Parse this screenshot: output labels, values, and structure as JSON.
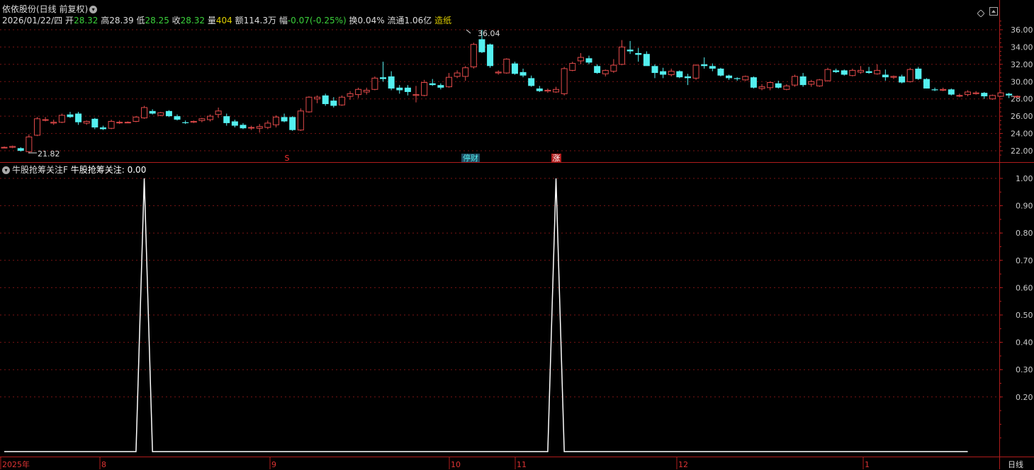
{
  "colors": {
    "up": "#e24a4a",
    "down": "#54f0f0",
    "grid": "#7a1414",
    "axis": "#b01c1c",
    "text": "#dddddd",
    "yellow": "#e0d000",
    "green": "#3bd13b",
    "red": "#ff4040"
  },
  "header": {
    "title": "依依股份(日线 前复权)",
    "date": "2026/01/22/四",
    "open_label": "开",
    "open": "28.32",
    "high_label": "高",
    "high": "28.39",
    "low_label": "低",
    "low": "28.25",
    "close_label": "收",
    "close": "28.32",
    "vol_label": "量",
    "vol": "404",
    "amt_label": "额",
    "amt": "114.3万",
    "chg_label": "幅",
    "chg": "-0.07(-0.25%)",
    "turn_label": "换",
    "turn": "0.04%",
    "float_label": "流通",
    "float": "1.06亿",
    "sector": "造纸"
  },
  "indicator": {
    "name": "牛股抢筹关注F",
    "label": "牛股抢筹关注:",
    "value": "0.00"
  },
  "price_axis": {
    "ticks": [
      "36.00",
      "34.00",
      "32.00",
      "30.00",
      "28.00",
      "26.00",
      "24.00",
      "22.00"
    ]
  },
  "ind_axis": {
    "ticks": [
      "1.00",
      "0.90",
      "0.80",
      "0.70",
      "0.60",
      "0.50",
      "0.40",
      "0.30",
      "0.20"
    ]
  },
  "annotations": {
    "high": "36.04",
    "low": "21.82"
  },
  "markers": [
    {
      "text": "S",
      "color": "#ff3030",
      "bg": "none",
      "x": 405
    },
    {
      "text": "停财",
      "color": "#54f0f0",
      "bg": "#1e4a60",
      "x": 664
    },
    {
      "text": "涨",
      "color": "#ffffff",
      "bg": "#b01c1c",
      "x": 785
    }
  ],
  "x_axis": {
    "labels": [
      {
        "text": "2025年",
        "x": 3
      },
      {
        "text": "8",
        "x": 143
      },
      {
        "text": "9",
        "x": 383
      },
      {
        "text": "10",
        "x": 636
      },
      {
        "text": "11",
        "x": 729
      },
      {
        "text": "12",
        "x": 957
      },
      {
        "text": "1",
        "x": 1220
      }
    ],
    "period": "日线"
  },
  "chart_data": [
    {
      "type": "candlestick",
      "title": "依依股份(日线 前复权)",
      "ylim": [
        21,
        37
      ],
      "y_ticks": [
        22,
        24,
        26,
        28,
        30,
        32,
        34,
        36
      ],
      "series": [
        {
          "values_ohlc": [
            [
              22.4,
              22.5,
              22.3,
              22.4
            ],
            [
              22.4,
              22.6,
              22.3,
              22.5
            ],
            [
              22.3,
              22.4,
              21.9,
              22.0
            ],
            [
              21.9,
              23.9,
              21.8,
              23.6
            ],
            [
              23.8,
              25.9,
              23.7,
              25.7
            ],
            [
              25.6,
              25.9,
              25.4,
              25.6
            ],
            [
              25.2,
              25.6,
              25.0,
              25.3
            ],
            [
              25.3,
              26.3,
              25.2,
              26.1
            ],
            [
              26.2,
              26.5,
              25.8,
              25.9
            ],
            [
              26.3,
              26.5,
              25.0,
              25.3
            ],
            [
              25.2,
              25.5,
              25.0,
              25.4
            ],
            [
              25.7,
              25.8,
              24.5,
              24.7
            ],
            [
              24.7,
              24.9,
              24.4,
              24.5
            ],
            [
              24.6,
              25.6,
              24.5,
              25.4
            ],
            [
              25.3,
              25.5,
              25.1,
              25.3
            ],
            [
              25.3,
              25.4,
              25.2,
              25.3
            ],
            [
              25.4,
              26.0,
              25.3,
              25.9
            ],
            [
              25.8,
              27.2,
              25.7,
              27.0
            ],
            [
              26.6,
              26.8,
              26.2,
              26.3
            ],
            [
              26.1,
              26.5,
              26.0,
              26.4
            ],
            [
              26.6,
              26.7,
              25.9,
              26.0
            ],
            [
              26.0,
              26.2,
              25.5,
              25.6
            ],
            [
              25.3,
              25.5,
              25.1,
              25.2
            ],
            [
              25.3,
              25.5,
              25.2,
              25.4
            ],
            [
              25.5,
              25.8,
              25.3,
              25.7
            ],
            [
              25.6,
              26.2,
              25.4,
              26.0
            ],
            [
              26.2,
              27.0,
              25.8,
              26.6
            ],
            [
              26.0,
              26.3,
              24.9,
              25.2
            ],
            [
              25.4,
              25.6,
              24.7,
              24.9
            ],
            [
              25.0,
              25.2,
              24.5,
              24.6
            ],
            [
              24.7,
              24.9,
              24.4,
              24.7
            ],
            [
              24.6,
              25.1,
              24.1,
              24.8
            ],
            [
              24.7,
              25.5,
              24.5,
              25.2
            ],
            [
              25.0,
              26.1,
              24.7,
              25.9
            ],
            [
              25.9,
              26.3,
              25.3,
              25.4
            ],
            [
              25.9,
              26.0,
              24.3,
              24.4
            ],
            [
              24.4,
              26.9,
              24.3,
              26.6
            ],
            [
              26.5,
              28.3,
              26.4,
              28.2
            ],
            [
              28.0,
              28.4,
              27.5,
              28.2
            ],
            [
              28.4,
              28.6,
              27.2,
              27.4
            ],
            [
              27.8,
              28.2,
              27.0,
              27.2
            ],
            [
              27.3,
              28.4,
              27.2,
              28.2
            ],
            [
              28.3,
              28.9,
              27.9,
              28.6
            ],
            [
              28.5,
              29.3,
              28.1,
              29.1
            ],
            [
              28.8,
              29.3,
              28.5,
              29.0
            ],
            [
              29.1,
              30.6,
              29.0,
              30.4
            ],
            [
              30.5,
              32.3,
              30.0,
              30.3
            ],
            [
              30.6,
              31.2,
              29.0,
              29.2
            ],
            [
              29.3,
              29.6,
              28.6,
              29.0
            ],
            [
              29.3,
              29.6,
              28.4,
              28.8
            ],
            [
              28.4,
              29.5,
              27.6,
              28.5
            ],
            [
              28.4,
              30.2,
              28.3,
              29.9
            ],
            [
              29.8,
              30.3,
              29.5,
              29.6
            ],
            [
              29.6,
              29.8,
              29.1,
              29.3
            ],
            [
              29.4,
              31.0,
              29.3,
              30.5
            ],
            [
              30.6,
              31.3,
              30.4,
              31.0
            ],
            [
              30.6,
              31.8,
              30.1,
              31.6
            ],
            [
              31.7,
              34.5,
              31.5,
              34.3
            ],
            [
              34.9,
              36.0,
              33.3,
              33.4
            ],
            [
              34.3,
              34.4,
              31.6,
              31.8
            ],
            [
              31.0,
              31.3,
              30.8,
              31.1
            ],
            [
              31.0,
              32.7,
              30.9,
              32.6
            ],
            [
              32.1,
              32.3,
              30.8,
              30.9
            ],
            [
              31.1,
              31.5,
              30.5,
              30.7
            ],
            [
              30.4,
              30.7,
              29.4,
              29.5
            ],
            [
              29.2,
              29.5,
              28.8,
              28.9
            ],
            [
              28.9,
              29.2,
              28.7,
              29.0
            ],
            [
              28.8,
              29.4,
              28.7,
              29.1
            ],
            [
              28.6,
              31.7,
              28.4,
              31.5
            ],
            [
              31.3,
              32.3,
              31.2,
              32.1
            ],
            [
              32.4,
              33.3,
              32.0,
              32.8
            ],
            [
              32.7,
              33.0,
              32.0,
              32.2
            ],
            [
              31.8,
              32.0,
              30.9,
              31.0
            ],
            [
              30.9,
              31.4,
              30.6,
              31.3
            ],
            [
              31.2,
              32.6,
              31.0,
              31.9
            ],
            [
              32.0,
              34.8,
              31.9,
              34.0
            ],
            [
              33.7,
              34.7,
              33.2,
              33.5
            ],
            [
              33.3,
              33.9,
              32.3,
              33.1
            ],
            [
              33.2,
              33.5,
              31.9,
              31.8
            ],
            [
              31.8,
              32.0,
              30.4,
              31.0
            ],
            [
              31.2,
              31.6,
              30.4,
              30.8
            ],
            [
              30.8,
              31.5,
              30.6,
              31.2
            ],
            [
              31.2,
              31.3,
              30.4,
              30.5
            ],
            [
              30.6,
              30.9,
              29.6,
              30.4
            ],
            [
              30.4,
              32.0,
              30.2,
              31.9
            ],
            [
              32.0,
              32.8,
              31.5,
              31.8
            ],
            [
              31.8,
              32.1,
              31.2,
              31.5
            ],
            [
              31.5,
              31.6,
              30.6,
              30.7
            ],
            [
              30.7,
              30.8,
              30.2,
              30.4
            ],
            [
              30.4,
              30.5,
              30.1,
              30.3
            ],
            [
              30.2,
              30.7,
              30.1,
              30.6
            ],
            [
              30.5,
              30.6,
              29.2,
              29.3
            ],
            [
              29.2,
              29.7,
              29.0,
              29.4
            ],
            [
              29.3,
              30.0,
              29.0,
              29.9
            ],
            [
              29.8,
              30.1,
              29.2,
              29.3
            ],
            [
              29.1,
              29.7,
              29.0,
              29.5
            ],
            [
              29.6,
              30.8,
              29.4,
              30.6
            ],
            [
              30.6,
              31.0,
              29.4,
              29.6
            ],
            [
              29.7,
              30.2,
              29.4,
              30.0
            ],
            [
              29.5,
              30.3,
              29.4,
              30.2
            ],
            [
              30.1,
              31.6,
              30.0,
              31.4
            ],
            [
              31.3,
              31.5,
              31.0,
              31.1
            ],
            [
              31.3,
              31.4,
              30.7,
              30.8
            ],
            [
              30.7,
              31.5,
              30.6,
              31.3
            ],
            [
              31.1,
              31.8,
              30.9,
              31.3
            ],
            [
              31.2,
              31.7,
              30.9,
              31.0
            ],
            [
              30.9,
              32.0,
              30.8,
              31.3
            ],
            [
              30.8,
              31.4,
              30.1,
              30.5
            ],
            [
              30.5,
              30.7,
              30.3,
              30.6
            ],
            [
              30.6,
              30.8,
              29.8,
              29.9
            ],
            [
              30.0,
              31.6,
              29.9,
              31.4
            ],
            [
              31.5,
              31.7,
              30.2,
              30.3
            ],
            [
              30.3,
              30.4,
              29.2,
              29.2
            ],
            [
              29.1,
              29.3,
              28.9,
              29.0
            ],
            [
              29.0,
              29.3,
              28.9,
              29.1
            ],
            [
              29.1,
              29.2,
              28.4,
              28.5
            ],
            [
              28.4,
              28.6,
              28.2,
              28.4
            ],
            [
              28.5,
              29.0,
              28.3,
              28.8
            ],
            [
              28.6,
              28.9,
              28.5,
              28.7
            ],
            [
              28.7,
              28.8,
              28.0,
              28.3
            ],
            [
              28.0,
              28.5,
              27.9,
              28.4
            ],
            [
              28.3,
              28.9,
              28.2,
              28.7
            ],
            [
              28.6,
              28.7,
              28.1,
              28.4
            ],
            [
              28.3,
              28.4,
              28.2,
              28.3
            ]
          ]
        }
      ],
      "high_annotation": 36.04,
      "low_annotation": 21.82
    },
    {
      "type": "line",
      "title": "牛股抢筹关注F",
      "ylim": [
        0,
        1.03
      ],
      "y_ticks": [
        0.2,
        0.3,
        0.4,
        0.5,
        0.6,
        0.7,
        0.8,
        0.9,
        1.0
      ],
      "series": [
        {
          "name": "牛股抢筹关注",
          "pulses_at_bar": [
            17,
            67
          ],
          "value_count": 118,
          "last_value": 0.0
        }
      ]
    }
  ]
}
